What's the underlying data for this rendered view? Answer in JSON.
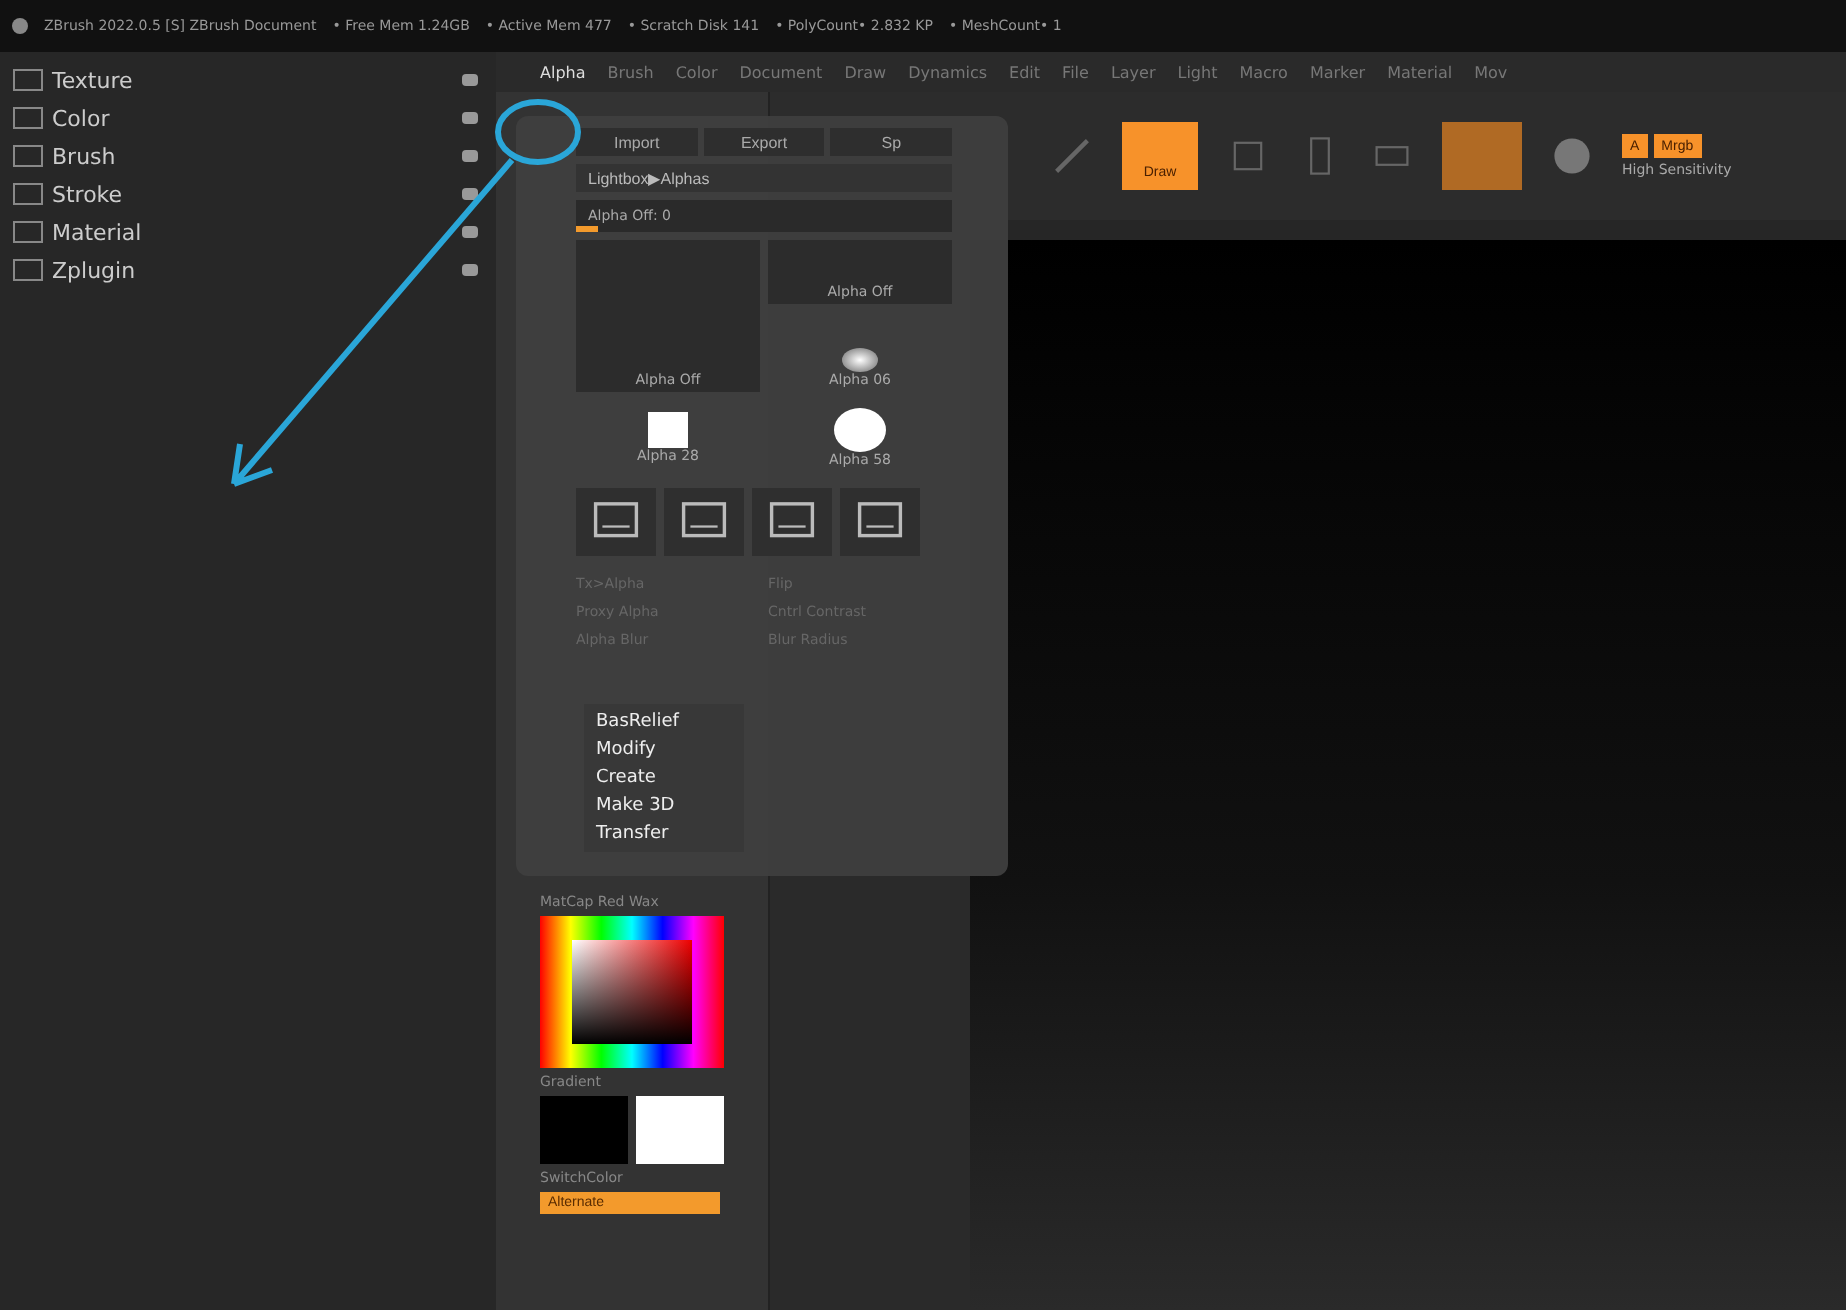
{
  "title_bar": {
    "app": "ZBrush 2022.0.5 [S]  ZBrush Document",
    "stats": [
      "• Free Mem 1.24GB",
      "• Active Mem 477",
      "• Scratch Disk 141",
      "• PolyCount• 2.832 KP",
      "• MeshCount• 1"
    ]
  },
  "palette_list": [
    {
      "label": "Texture"
    },
    {
      "label": "Color"
    },
    {
      "label": "Brush"
    },
    {
      "label": "Stroke"
    },
    {
      "label": "Material"
    },
    {
      "label": "Zplugin"
    }
  ],
  "menu": [
    {
      "label": "Alpha",
      "selected": true
    },
    {
      "label": "Brush",
      "selected": false
    },
    {
      "label": "Color",
      "selected": false
    },
    {
      "label": "Document",
      "selected": false
    },
    {
      "label": "Draw",
      "selected": false
    },
    {
      "label": "Dynamics",
      "selected": false
    },
    {
      "label": "Edit",
      "selected": false
    },
    {
      "label": "File",
      "selected": false
    },
    {
      "label": "Layer",
      "selected": false
    },
    {
      "label": "Light",
      "selected": false
    },
    {
      "label": "Macro",
      "selected": false
    },
    {
      "label": "Marker",
      "selected": false
    },
    {
      "label": "Material",
      "selected": false
    },
    {
      "label": "Mov",
      "selected": false
    }
  ],
  "toolbar": {
    "draw_button": "Draw",
    "a_button": "A",
    "mrgb_button": "Mrgb",
    "sensitivity": "High Sensitivity"
  },
  "alpha_popup": {
    "buttons": [
      "Import",
      "Export",
      "Sp"
    ],
    "lightbox": "Lightbox▶Alphas",
    "current": "Alpha Off: 0",
    "level": 0.06,
    "preview": {
      "label": "Alpha Off"
    },
    "thumbs": [
      {
        "label": "Alpha Off",
        "kind": "small"
      },
      {
        "label": "Alpha 06",
        "kind": "soft"
      },
      {
        "label": "Alpha 28",
        "kind": "square"
      },
      {
        "label": "Alpha 58",
        "kind": "circle"
      }
    ],
    "rows": [
      "Tx>Alpha",
      "Flip",
      "Proxy Alpha",
      "Cntrl Contrast",
      "Alpha Blur",
      "Blur Radius"
    ]
  },
  "tray_menu": [
    "BasRelief",
    "Modify",
    "Create",
    "Make 3D",
    "Transfer"
  ],
  "material_label": "MatCap Red Wax",
  "gradient_label": "Gradient",
  "switch_label": "SwitchColor",
  "alternate_button": "Alternate"
}
